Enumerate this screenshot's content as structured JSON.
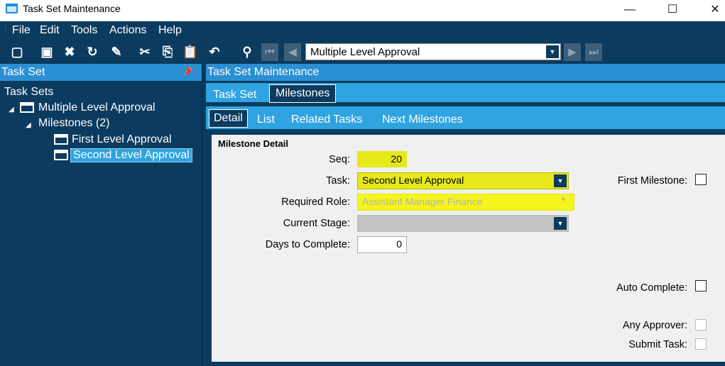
{
  "window": {
    "title": "Task Set Maintenance",
    "minimize": "—",
    "maximize": "☐",
    "close": "✕"
  },
  "menu": [
    "File",
    "Edit",
    "Tools",
    "Actions",
    "Help"
  ],
  "toolbar": {
    "record_selector_value": "Multiple Level Approval",
    "icons": [
      "new-icon",
      "save-icon",
      "delete-icon",
      "refresh-icon",
      "clear-icon",
      "cut-icon",
      "copy-icon",
      "paste-icon",
      "undo-icon",
      "search-icon",
      "first-icon",
      "prev-icon",
      "next-icon",
      "last-icon"
    ]
  },
  "left_panel": {
    "title": "Task Set",
    "tree": {
      "root": "Task Sets",
      "task_set": "Multiple Level Approval",
      "milestones": "Milestones (2)",
      "items": [
        "First Level Approval",
        "Second Level Approval"
      ]
    }
  },
  "right_panel": {
    "title": "Task Set Maintenance",
    "tabs": [
      "Task Set",
      "Milestones"
    ],
    "subtabs": [
      "Detail",
      "List",
      "Related Tasks",
      "Next Milestones"
    ],
    "section_title": "Milestone Detail",
    "fields": {
      "seq_label": "Seq:",
      "seq_value": "20",
      "task_label": "Task:",
      "task_value": "Second Level Approval",
      "role_label": "Required Role:",
      "role_value": "Assistant Manager Finance",
      "stage_label": "Current Stage:",
      "stage_value": "",
      "days_label": "Days to Complete:",
      "days_value": "0",
      "first_milestone_label": "First Milestone:",
      "auto_complete_label": "Auto Complete:",
      "any_approver_label": "Any Approver:",
      "submit_task_label": "Submit Task:"
    }
  },
  "colors": {
    "dark": "#0b3b5e",
    "accent": "#2fa4e0",
    "highlight": "#e6e81a"
  }
}
